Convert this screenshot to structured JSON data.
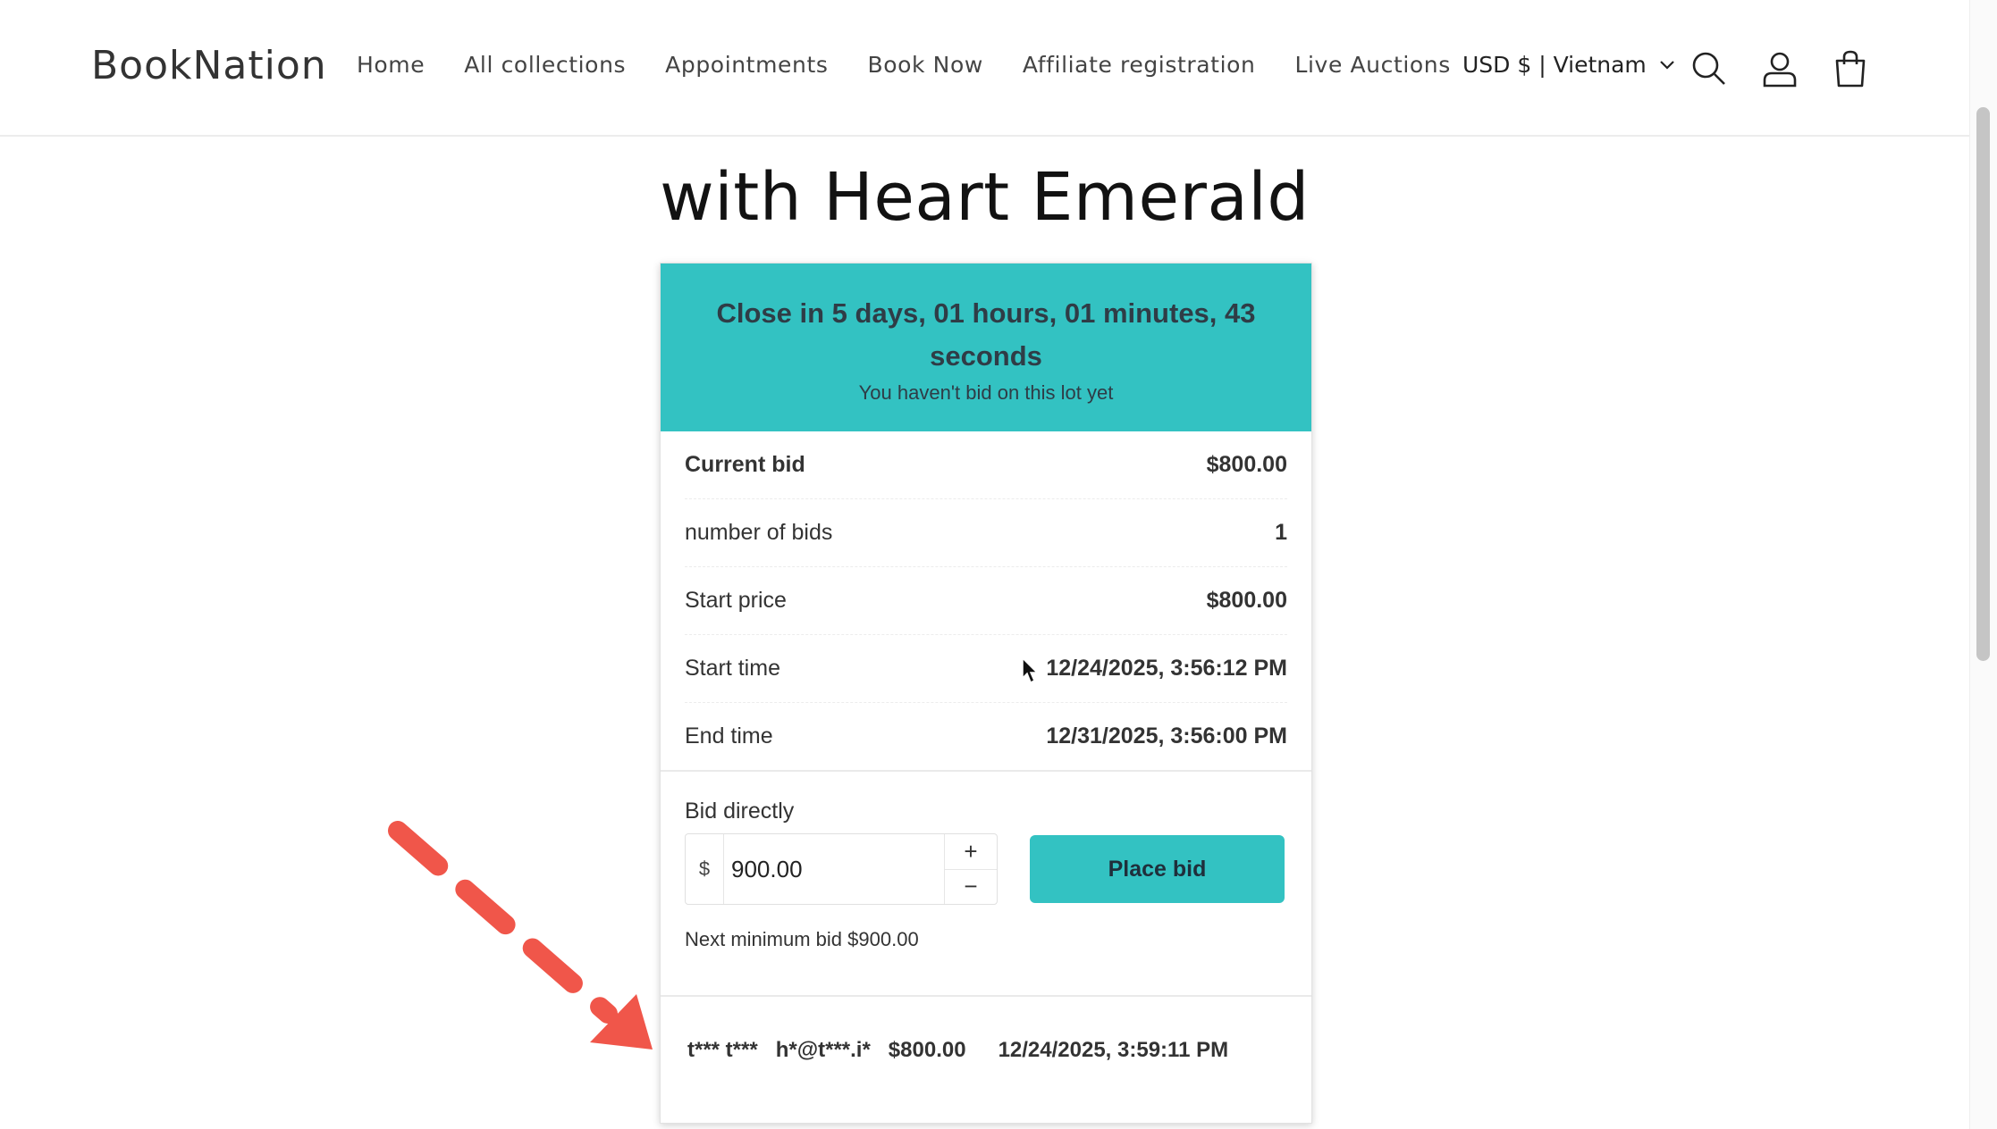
{
  "header": {
    "logo": "BookNation",
    "nav": [
      "Home",
      "All collections",
      "Appointments",
      "Book Now",
      "Affiliate registration",
      "Live Auctions"
    ],
    "currency": "USD $ | Vietnam",
    "icons": [
      "search-icon",
      "account-icon",
      "cart-icon"
    ]
  },
  "page": {
    "title": "with Heart Emerald"
  },
  "auction": {
    "countdown": "Close in 5 days, 01 hours, 01 minutes, 43 seconds",
    "status": "You haven't bid on this lot yet",
    "rows": [
      {
        "label": "Current bid",
        "value": "$800.00"
      },
      {
        "label": "number of bids",
        "value": "1"
      },
      {
        "label": "Start price",
        "value": "$800.00"
      },
      {
        "label": "Start time",
        "value": "12/24/2025, 3:56:12 PM"
      },
      {
        "label": "End time",
        "value": "12/31/2025, 3:56:00 PM"
      }
    ],
    "bid_label": "Bid directly",
    "currency_symbol": "$",
    "bid_amount": "900.00",
    "place_bid": "Place bid",
    "next_min": "Next minimum bid $900.00",
    "history": {
      "name": "t*** t***",
      "email": "h*@t***.i*",
      "amount": "$800.00",
      "time": "12/24/2025, 3:59:11 PM"
    }
  },
  "colors": {
    "accent": "#33c2c2",
    "annotation": "#f0564a"
  }
}
